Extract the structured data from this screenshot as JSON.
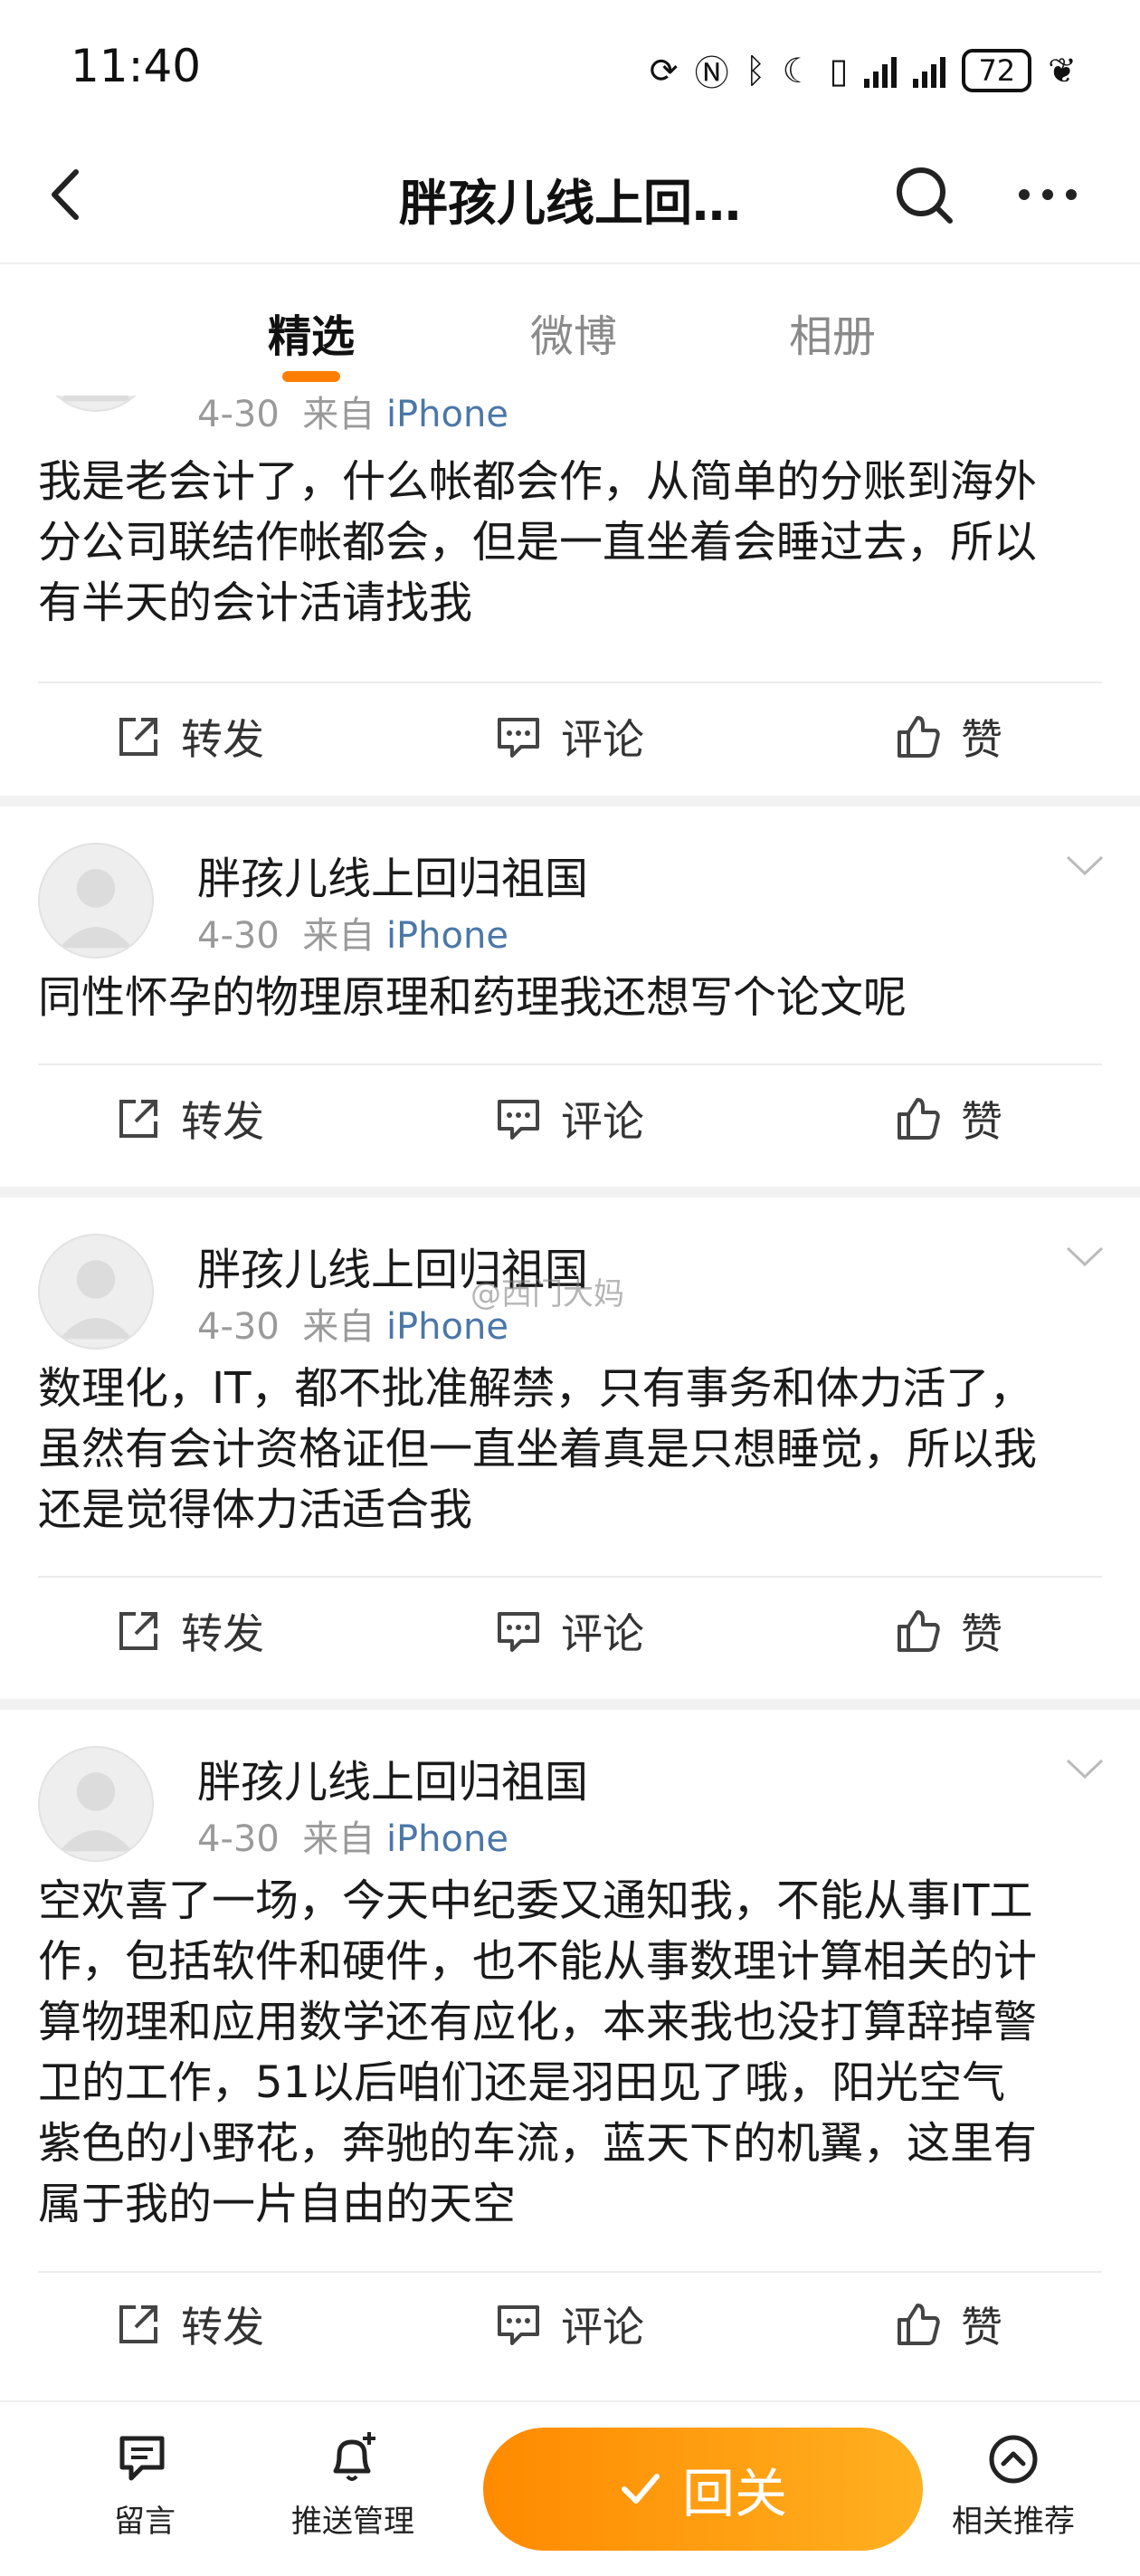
{
  "status_bar": {
    "time": "11:40",
    "battery": "72"
  },
  "nav": {
    "title": "胖孩儿线上回…"
  },
  "tabs": [
    {
      "label": "精选",
      "active": true
    },
    {
      "label": "微博",
      "active": false
    },
    {
      "label": "相册",
      "active": false
    }
  ],
  "posts": [
    {
      "author": "",
      "date": "4-30",
      "via": "来自",
      "source": "iPhone",
      "lines": [
        "我是老会计了，什么帐都会作，从简单的分账到海外",
        "分公司联结作帐都会，但是一直坐着会睡过去，所以",
        "有半天的会计活请找我"
      ]
    },
    {
      "author": "胖孩儿线上回归祖国",
      "date": "4-30",
      "via": "来自",
      "source": "iPhone",
      "lines": [
        "同性怀孕的物理原理和药理我还想写个论文呢"
      ]
    },
    {
      "author": "胖孩儿线上回归祖国",
      "date": "4-30",
      "via": "来自",
      "source": "iPhone",
      "lines": [
        "数理化，IT，都不批准解禁，只有事务和体力活了，",
        "虽然有会计资格证但一直坐着真是只想睡觉，所以我",
        "还是觉得体力活适合我"
      ]
    },
    {
      "author": "胖孩儿线上回归祖国",
      "date": "4-30",
      "via": "来自",
      "source": "iPhone",
      "lines": [
        "空欢喜了一场，今天中纪委又通知我，不能从事IT工",
        "作，包括软件和硬件，也不能从事数理计算相关的计",
        "算物理和应用数学还有应化，本来我也没打算辞掉警",
        "卫的工作，51以后咱们还是羽田见了哦，阳光空气",
        "紫色的小野花，奔驰的车流，蓝天下的机翼，这里有",
        "属于我的一片自由的天空"
      ]
    }
  ],
  "actions": {
    "repost": "转发",
    "comment": "评论",
    "like": "赞"
  },
  "watermark": "@西门大妈",
  "bottom_bar": {
    "message": "留言",
    "push": "推送管理",
    "follow": "回关",
    "related": "相关推荐"
  }
}
